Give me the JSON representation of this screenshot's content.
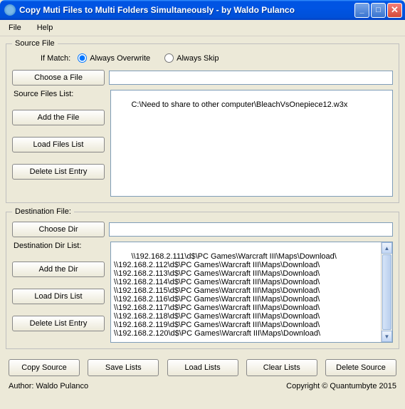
{
  "window": {
    "title": "Copy Muti Files to Multi Folders Simultaneously - by Waldo Pulanco"
  },
  "menu": {
    "file": "File",
    "help": "Help"
  },
  "source": {
    "legend": "Source File",
    "ifMatch": "If Match:",
    "alwaysOverwrite": "Always Overwrite",
    "alwaysSkip": "Always Skip",
    "chooseFile": "Choose a File",
    "filesListLabel": "Source Files List:",
    "filesList": "C:\\Need to share to other computer\\BleachVsOnepiece12.w3x",
    "addFile": "Add the File",
    "loadList": "Load Files List",
    "deleteEntry": "Delete List Entry",
    "fileInputValue": ""
  },
  "dest": {
    "legend": "Destination File:",
    "chooseDir": "Choose Dir",
    "dirListLabel": "Destination Dir List:",
    "dirInputValue": "",
    "dirList": "\\\\192.168.2.111\\d$\\PC Games\\Warcraft III\\Maps\\Download\\\n\\\\192.168.2.112\\d$\\PC Games\\Warcraft III\\Maps\\Download\\\n\\\\192.168.2.113\\d$\\PC Games\\Warcraft III\\Maps\\Download\\\n\\\\192.168.2.114\\d$\\PC Games\\Warcraft III\\Maps\\Download\\\n\\\\192.168.2.115\\d$\\PC Games\\Warcraft III\\Maps\\Download\\\n\\\\192.168.2.116\\d$\\PC Games\\Warcraft III\\Maps\\Download\\\n\\\\192.168.2.117\\d$\\PC Games\\Warcraft III\\Maps\\Download\\\n\\\\192.168.2.118\\d$\\PC Games\\Warcraft III\\Maps\\Download\\\n\\\\192.168.2.119\\d$\\PC Games\\Warcraft III\\Maps\\Download\\\n\\\\192.168.2.120\\d$\\PC Games\\Warcraft III\\Maps\\Download\\",
    "addDir": "Add the Dir",
    "loadDirs": "Load Dirs List",
    "deleteEntry": "Delete List Entry"
  },
  "bottom": {
    "copySource": "Copy Source",
    "saveLists": "Save Lists",
    "loadLists": "Load Lists",
    "clearLists": "Clear Lists",
    "deleteSource": "Delete Source"
  },
  "footer": {
    "author": "Author: Waldo Pulanco",
    "copyright": "Copyright © Quantumbyte 2015"
  }
}
